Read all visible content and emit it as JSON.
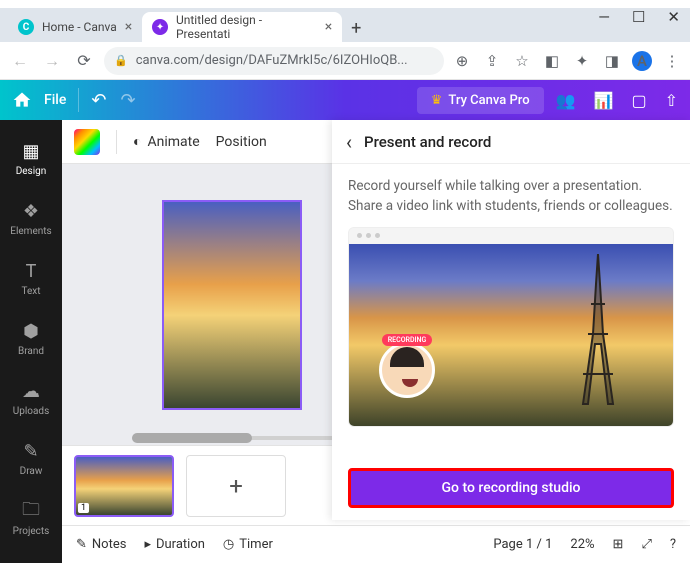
{
  "browser": {
    "tabs": [
      {
        "title": "Home - Canva",
        "favicon_color": "#00c4cc"
      },
      {
        "title": "Untitled design - Presentati",
        "favicon_color": "#7d2ae8"
      }
    ],
    "url": "canva.com/design/DAFuZMrkI5c/6IZOHIoQB...",
    "profile_letter": "A"
  },
  "topbar": {
    "file_label": "File",
    "pro_label": "Try Canva Pro"
  },
  "sidebar": {
    "items": [
      {
        "label": "Design",
        "icon": "template"
      },
      {
        "label": "Elements",
        "icon": "shapes"
      },
      {
        "label": "Text",
        "icon": "text"
      },
      {
        "label": "Brand",
        "icon": "brand"
      },
      {
        "label": "Uploads",
        "icon": "cloud"
      },
      {
        "label": "Draw",
        "icon": "draw"
      },
      {
        "label": "Projects",
        "icon": "folder"
      }
    ]
  },
  "toolbar": {
    "animate_label": "Animate",
    "position_label": "Position"
  },
  "panel": {
    "title": "Present and record",
    "description": "Record yourself while talking over a presentation. Share a video link with students, friends or colleagues.",
    "recording_badge": "RECORDING",
    "cta_label": "Go to recording studio"
  },
  "thumbs": {
    "page1_number": "1"
  },
  "bottombar": {
    "notes_label": "Notes",
    "duration_label": "Duration",
    "timer_label": "Timer",
    "page_label": "Page 1 / 1",
    "zoom_label": "22%"
  }
}
